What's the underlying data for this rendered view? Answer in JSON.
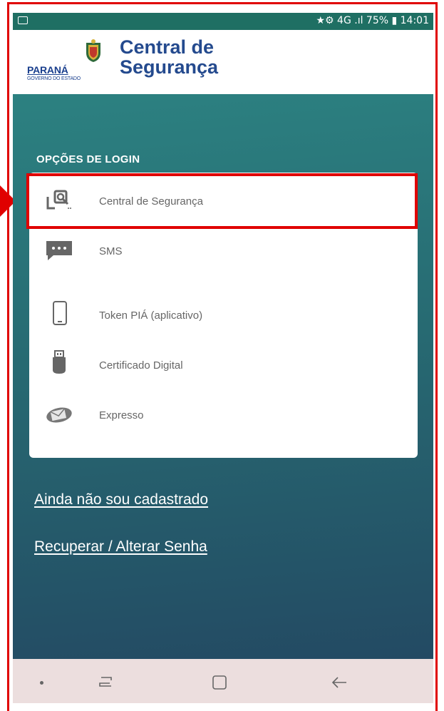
{
  "status_bar": {
    "right_text": "★⚙ 4G .ıl 75% ▮ 14:01",
    "battery": "75%",
    "time": "14:01"
  },
  "header": {
    "logo_text_top": "PARANÁ",
    "logo_text_bottom": "GOVERNO DO ESTADO",
    "title_line1": "Central de",
    "title_line2": "Segurança"
  },
  "login": {
    "section_label": "OPÇÕES DE LOGIN",
    "options": [
      {
        "label": "Central de Segurança",
        "icon": "central-seguranca-icon"
      },
      {
        "label": "SMS",
        "icon": "sms-icon"
      },
      {
        "label": "Token PIÁ (aplicativo)",
        "icon": "smartphone-icon"
      },
      {
        "label": "Certificado Digital",
        "icon": "usb-token-icon"
      },
      {
        "label": "Expresso",
        "icon": "expresso-mail-icon"
      }
    ]
  },
  "links": {
    "register": "Ainda não sou cadastrado",
    "recover": "Recuperar / Alterar Senha"
  },
  "colors": {
    "accent_red": "#e00000",
    "brand_blue": "#244a8e",
    "status_bar_green": "#1f6f63",
    "gradient_top": "#2c8181",
    "gradient_bottom": "#234a63"
  }
}
